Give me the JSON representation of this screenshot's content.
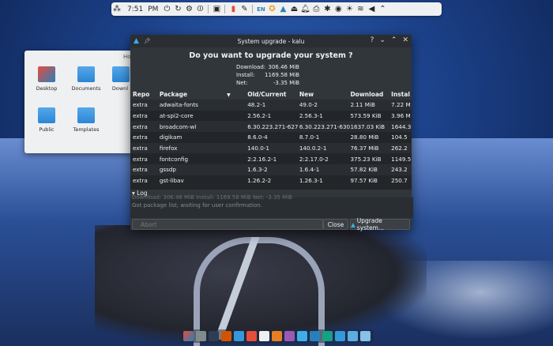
{
  "topbar": {
    "time": "7:51",
    "ampm": "PM",
    "lang": "EN",
    "icons": [
      "network-icon",
      "sync-icon",
      "settings-icon",
      "power-icon",
      "calculator-icon",
      "red-app-icon",
      "arch-update-icon",
      "eject-icon",
      "wifi-icon",
      "volume-icon"
    ]
  },
  "files": {
    "title": "Ho",
    "items": [
      {
        "label": "Desktop"
      },
      {
        "label": "Documents"
      },
      {
        "label": "Downl"
      },
      {
        "label": "Public"
      },
      {
        "label": "Templates"
      }
    ]
  },
  "dialog": {
    "title": "System upgrade - kalu",
    "question": "Do you want to upgrade your system ?",
    "summary": [
      {
        "key": "Download:",
        "value": "306.46 MiB"
      },
      {
        "key": "Install:",
        "value": "1169.58 MiB"
      },
      {
        "key": "Net:",
        "value": "-3.35 MiB"
      }
    ],
    "columns": [
      "Repo",
      "Package",
      "Old/Current",
      "New",
      "Download",
      "Instal"
    ],
    "rows": [
      [
        "extra",
        "adwaita-fonts",
        "48.2-1",
        "49.0-2",
        "2.11 MiB",
        "7.22 M"
      ],
      [
        "extra",
        "at-spi2-core",
        "2.56.2-1",
        "2.56.3-1",
        "573.59 KiB",
        "3.96 M"
      ],
      [
        "extra",
        "broadcom-wl",
        "6.30.223.271-627",
        "6.30.223.271-630",
        "1637.03 KiB",
        "1644.3"
      ],
      [
        "extra",
        "digikam",
        "8.6.0-4",
        "8.7.0-1",
        "28.80 MiB",
        "104.5"
      ],
      [
        "extra",
        "firefox",
        "140.0-1",
        "140.0.2-1",
        "76.37 MiB",
        "262.2"
      ],
      [
        "extra",
        "fontconfig",
        "2:2.16.2-1",
        "2:2.17.0-2",
        "375.23 KiB",
        "1149.5"
      ],
      [
        "extra",
        "gssdp",
        "1.6.3-2",
        "1.6.4-1",
        "57.82 KiB",
        "243.2"
      ],
      [
        "extra",
        "gst-libav",
        "1.26.2-2",
        "1.26.3-1",
        "97.57 KiB",
        "250.7"
      ]
    ],
    "log_label": "Log",
    "log_line1": "Download: 306.46 MiB   Install: 1169.58 MiB   Net: -3.35 MiB",
    "log_line2": "Got package list; waiting for user confirmation.",
    "abort": "Abort",
    "close": "Close",
    "upgrade": "Upgrade system..."
  }
}
